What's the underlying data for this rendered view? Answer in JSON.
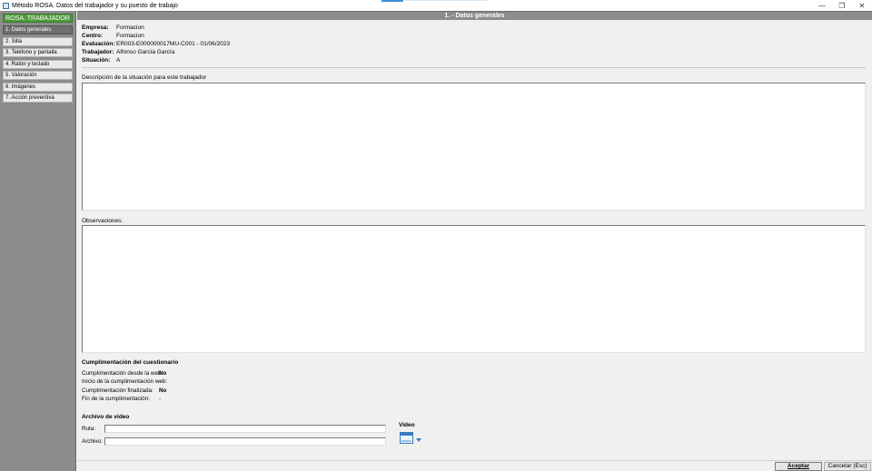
{
  "window": {
    "title": "Método ROSA. Datos del trabajador y su puesto de trabajo",
    "controls": {
      "minimize": "—",
      "restore": "❐",
      "close": "✕"
    }
  },
  "sidebar": {
    "header": "ROSA. TRABAJADOR",
    "items": [
      {
        "label": "1. Datos generales",
        "active": true
      },
      {
        "label": "2. Silla",
        "active": false
      },
      {
        "label": "3. Teléfono y pantalla",
        "active": false
      },
      {
        "label": "4. Ratón y teclado",
        "active": false
      },
      {
        "label": "5. Valoración",
        "active": false
      },
      {
        "label": "6. Imágenes",
        "active": false
      },
      {
        "label": "7. Acción preventiva",
        "active": false
      }
    ]
  },
  "main": {
    "header": "1. - Datos generales",
    "info": {
      "empresa_label": "Empresa:",
      "empresa_value": "Formacion",
      "centro_label": "Centro:",
      "centro_value": "Formacion",
      "evaluacion_label": "Evaluación:",
      "evaluacion_value": "ER003-E000000017MU-C001 - 01/06/2023",
      "trabajador_label": "Trabajador:",
      "trabajador_value": "Alfonso García García",
      "situacion_label": "Situación:",
      "situacion_value": "A"
    },
    "descripcion_label": "Descripción de la situación para este trabajador",
    "descripcion_value": "",
    "observaciones_label": "Observaciones:",
    "observaciones_value": "",
    "cumplimentacion": {
      "title": "Cumplimentación del cuestionario",
      "rows": [
        {
          "label": "Cumplimentación desde la web:",
          "value": "No"
        },
        {
          "label": "Inicio de la cumplimentación web:",
          "value": "-"
        },
        {
          "label": "Cumplimentación finalizada:",
          "value": "No"
        },
        {
          "label": "Fin de la cumplimentación:",
          "value": "-"
        }
      ]
    },
    "video": {
      "title": "Archivo de video",
      "ruta_label": "Ruta:",
      "ruta_value": "",
      "archivo_label": "Archivo:",
      "archivo_value": "",
      "video_label": "Video",
      "icon": "video-calendar-icon"
    }
  },
  "footer": {
    "accept_label": "Aceptar",
    "cancel_label": "Cancelar (Esc)"
  },
  "colors": {
    "sidebar_bg": "#8c8c8c",
    "sidebar_header_bg": "#4e9a3a",
    "active_item_bg": "#6f6f6f",
    "header_bg": "#8c8c8c",
    "accent": "#3b7bc1"
  }
}
